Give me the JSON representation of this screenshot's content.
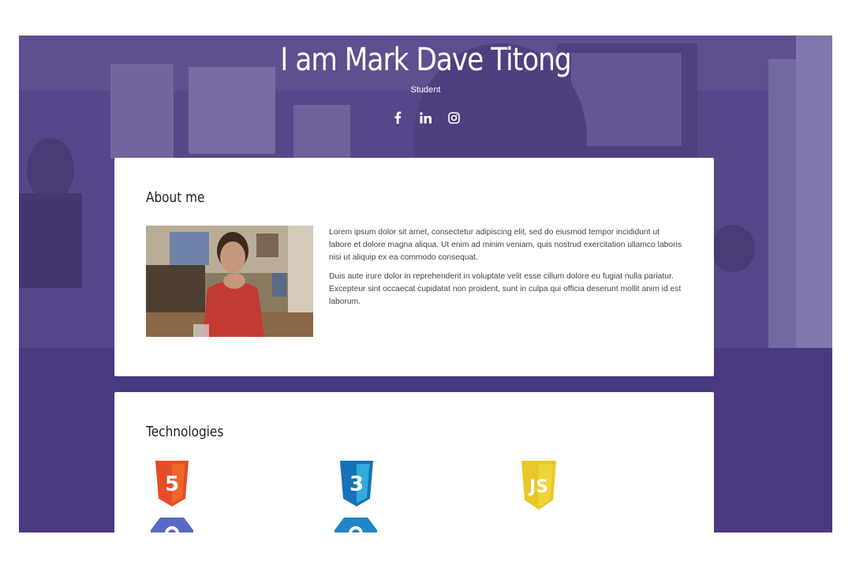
{
  "hero": {
    "title": "I am Mark Dave Titong",
    "subtitle": "Student",
    "social": [
      "facebook-icon",
      "linkedin-icon",
      "instagram-icon"
    ]
  },
  "about": {
    "heading": "About me",
    "paragraphs": [
      "Lorem ipsum dolor sit amet, consectetur adipiscing elit, sed do eiusmod tempor incididunt ut labore et dolore magna aliqua. Ut enim ad minim veniam, quis nostrud exercitation ullamco laboris nisi ut aliquip ex ea commodo consequat.",
      "Duis aute irure dolor in reprehenderit in voluptate velit esse cillum dolore eu fugiat nulla pariatur. Excepteur sint occaecat cupidatat non proident, sunt in culpa qui officia deserunt mollit anim id est laborum."
    ]
  },
  "technologies": {
    "heading": "Technologies",
    "icons": [
      "html5-icon",
      "css3-icon",
      "javascript-icon",
      "bootstrap-icon",
      "css-framework-icon"
    ]
  },
  "colors": {
    "hero_purple": "#4b3a80",
    "html5": "#e44d26",
    "css3": "#1572b6",
    "js": "#e8c82a"
  }
}
